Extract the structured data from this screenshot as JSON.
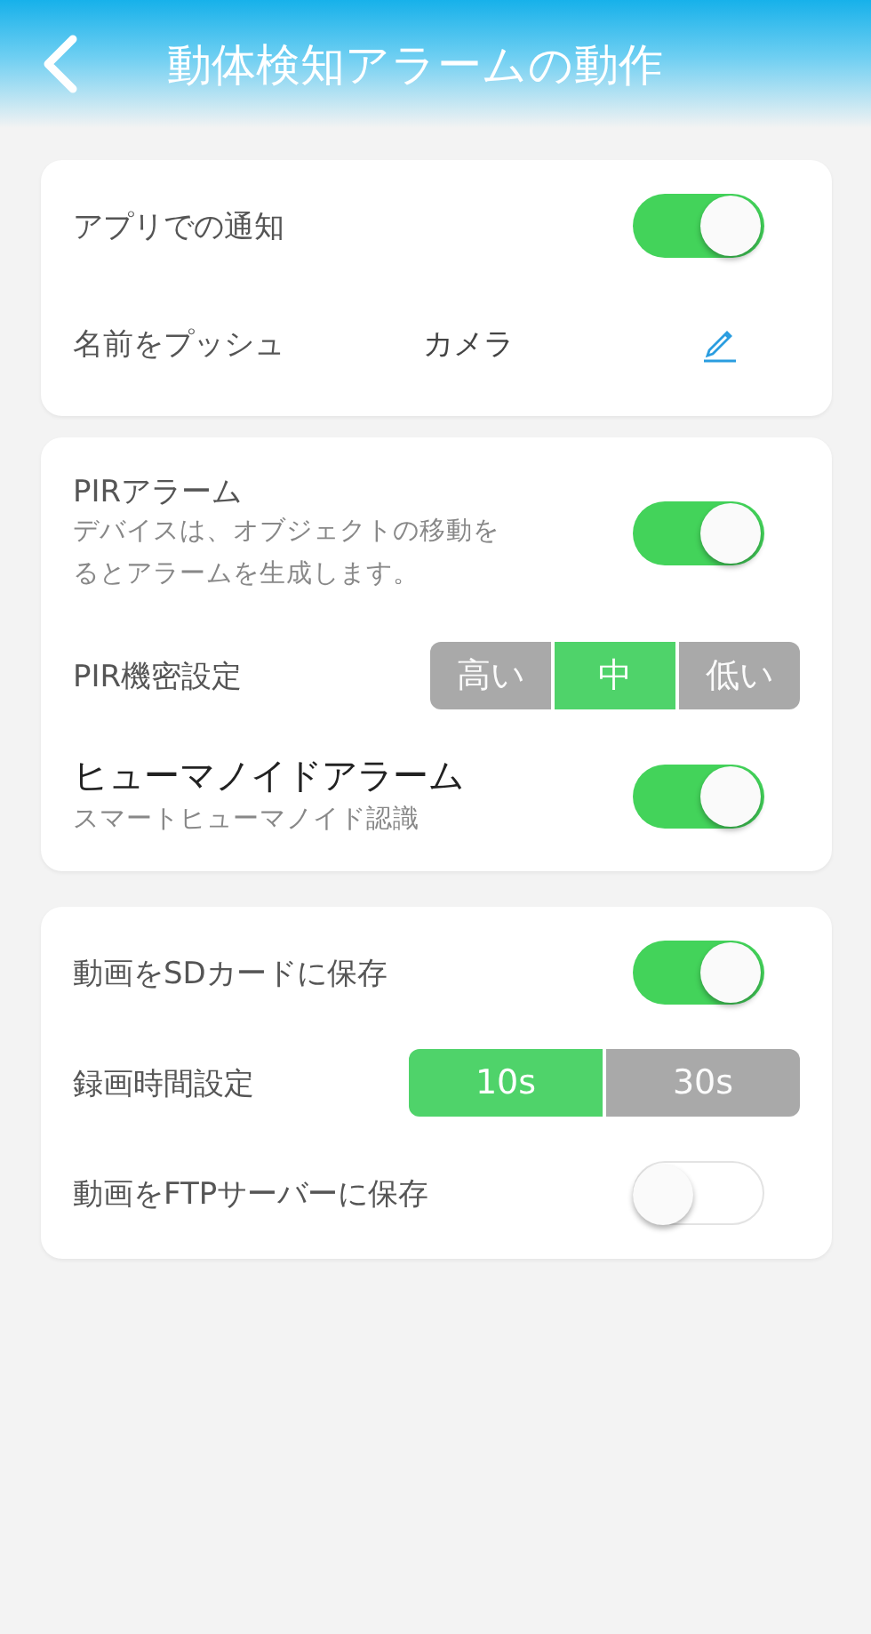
{
  "header": {
    "title": "動体検知アラームの動作"
  },
  "sections": [
    {
      "rows": [
        {
          "kind": "toggle",
          "label": "アプリでの通知",
          "on": true
        },
        {
          "kind": "value",
          "label": "名前をプッシュ",
          "value": "カメラ"
        }
      ]
    },
    {
      "rows": [
        {
          "kind": "toggle",
          "label": "PIRアラーム",
          "description_lines": [
            "デバイスは、オブジェクトの移動を",
            "るとアラームを生成します。"
          ],
          "on": true
        },
        {
          "kind": "segmented",
          "label": "PIR機密設定",
          "options": [
            {
              "label": "高い",
              "selected": false
            },
            {
              "label": "中",
              "selected": true
            },
            {
              "label": "低い",
              "selected": false
            }
          ]
        },
        {
          "kind": "toggle",
          "label": "ヒューマノイドアラーム",
          "emphasis": true,
          "description_lines": [
            "スマートヒューマノイド認識"
          ],
          "on": true
        }
      ]
    },
    {
      "rows": [
        {
          "kind": "toggle",
          "label": "動画をSDカードに保存",
          "on": true
        },
        {
          "kind": "segmented",
          "label": "録画時間設定",
          "wide": true,
          "options": [
            {
              "label": "10s",
              "selected": true
            },
            {
              "label": "30s",
              "selected": false
            }
          ]
        },
        {
          "kind": "toggle",
          "label": "動画をFTPサーバーに保存",
          "on": false
        }
      ]
    }
  ]
}
